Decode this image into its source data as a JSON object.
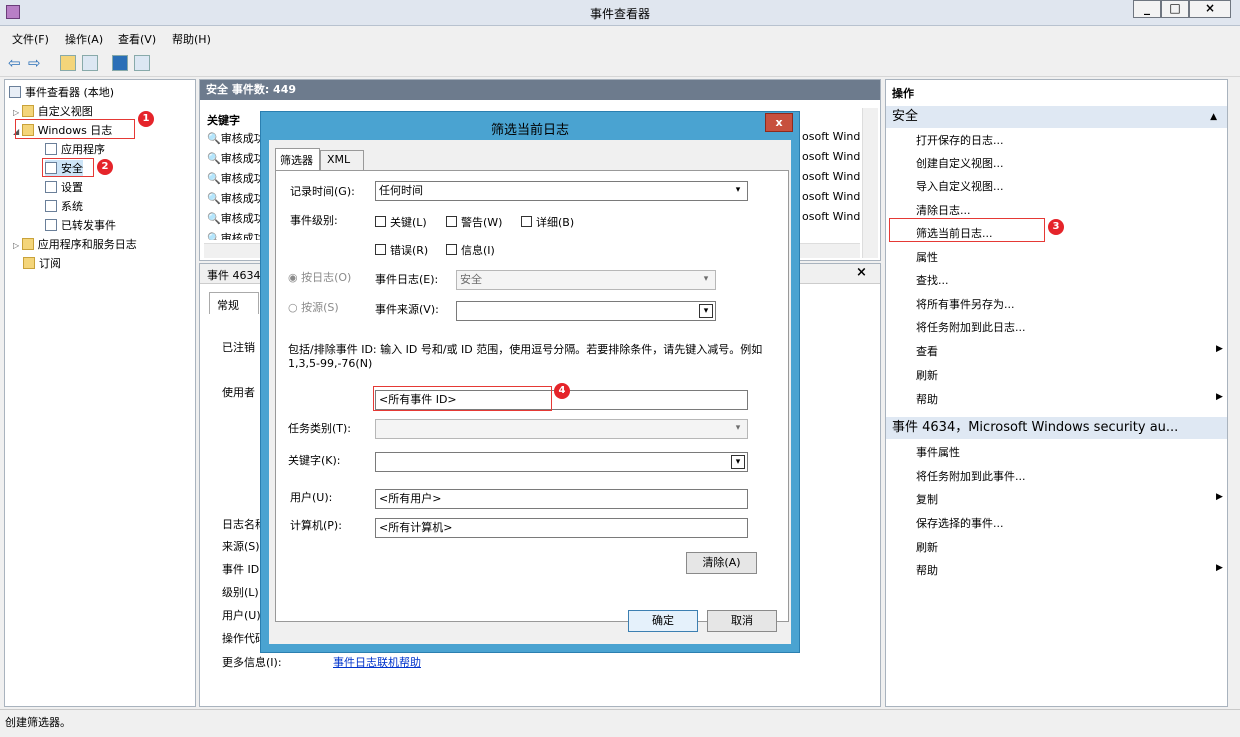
{
  "window": {
    "title": "事件查看器",
    "min": "_",
    "max": "□",
    "close": "×"
  },
  "menu": [
    "文件(F)",
    "操作(A)",
    "查看(V)",
    "帮助(H)"
  ],
  "tree": {
    "root": "事件查看器 (本地)",
    "custom_views": "自定义视图",
    "windows_logs": "Windows 日志",
    "app": "应用程序",
    "security": "安全",
    "setup": "设置",
    "system": "系统",
    "forwarded": "已转发事件",
    "app_services": "应用程序和服务日志",
    "subscriptions": "订阅"
  },
  "list": {
    "header": "安全    事件数: 449",
    "col_keyword": "关键字",
    "rows": [
      "审核成功",
      "审核成功",
      "审核成功",
      "审核成功",
      "审核成功",
      "审核成功"
    ],
    "source_frag": "osoft Wind"
  },
  "detail": {
    "header": "事件 4634",
    "tab_general": "常规",
    "logged_prefix": "已注销",
    "user_prefix": "使用者",
    "labels": [
      "日志名称",
      "来源(S)",
      "事件 ID",
      "级别(L)",
      "用户(U)",
      "操作代码"
    ],
    "more_info_label": "更多信息(I):",
    "more_info_link": "事件日志联机帮助"
  },
  "actions": {
    "title": "操作",
    "section1": "安全",
    "items1": [
      "打开保存的日志...",
      "创建自定义视图...",
      "导入自定义视图...",
      "清除日志...",
      "筛选当前日志...",
      "属性",
      "查找...",
      "将所有事件另存为...",
      "将任务附加到此日志...",
      "查看",
      "刷新",
      "帮助"
    ],
    "section2": "事件 4634，Microsoft Windows security au...",
    "items2": [
      "事件属性",
      "将任务附加到此事件...",
      "复制",
      "保存选择的事件...",
      "刷新",
      "帮助"
    ]
  },
  "dialog": {
    "title": "筛选当前日志",
    "close": "x",
    "tab_filter": "筛选器",
    "tab_xml": "XML",
    "logged_label": "记录时间(G):",
    "logged_value": "任何时间",
    "level_label": "事件级别:",
    "levels": [
      "关键(L)",
      "警告(W)",
      "详细(B)",
      "错误(R)",
      "信息(I)"
    ],
    "by_log": "按日志(O)",
    "by_source": "按源(S)",
    "event_logs_label": "事件日志(E):",
    "event_logs_value": "安全",
    "event_sources_label": "事件来源(V):",
    "help_text": "包括/排除事件 ID: 输入 ID 号和/或 ID 范围，使用逗号分隔。若要排除条件，请先键入减号。例如 1,3,5-99,-76(N)",
    "event_id_value": "<所有事件 ID>",
    "task_label": "任务类别(T):",
    "keywords_label": "关键字(K):",
    "user_label": "用户(U):",
    "user_value": "<所有用户>",
    "computer_label": "计算机(P):",
    "computer_value": "<所有计算机>",
    "clear": "清除(A)",
    "ok": "确定",
    "cancel": "取消"
  },
  "annotations": [
    "1",
    "2",
    "3",
    "4"
  ],
  "status": "创建筛选器。",
  "colors": {
    "accent": "#4aa3d1",
    "badge": "#e5242a",
    "header": "#6d7b8d"
  }
}
